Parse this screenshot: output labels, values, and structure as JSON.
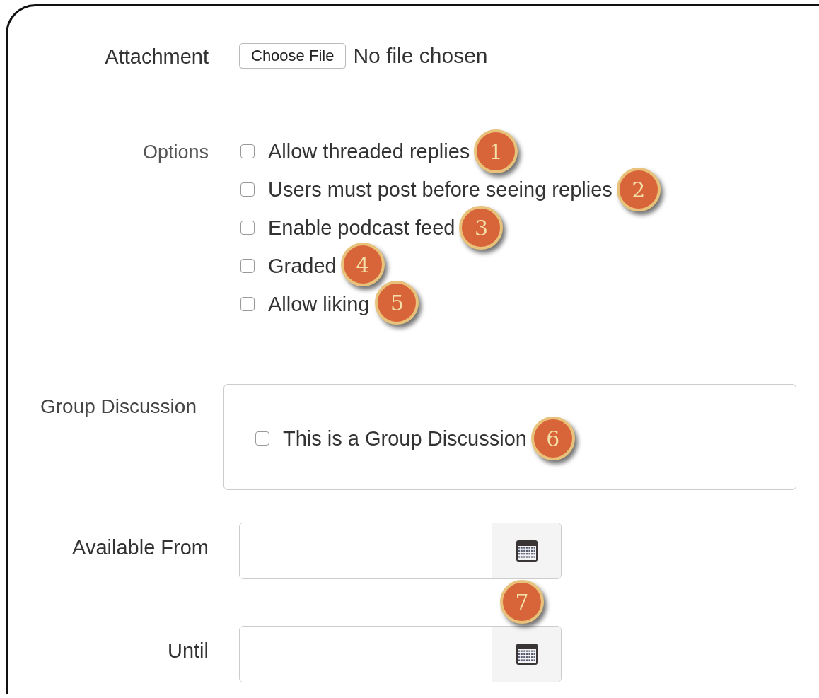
{
  "attachment": {
    "label": "Attachment",
    "button": "Choose File",
    "status": "No file chosen"
  },
  "options": {
    "label": "Options",
    "items": [
      {
        "label": "Allow threaded replies",
        "checked": false,
        "badge": "1"
      },
      {
        "label": "Users must post before seeing replies",
        "checked": false,
        "badge": "2"
      },
      {
        "label": "Enable podcast feed",
        "checked": false,
        "badge": "3"
      },
      {
        "label": "Graded",
        "checked": false,
        "badge": "4"
      },
      {
        "label": "Allow liking",
        "checked": false,
        "badge": "5"
      }
    ]
  },
  "group_discussion": {
    "label": "Group Discussion",
    "checkbox": {
      "label": "This is a Group Discussion",
      "checked": false,
      "badge": "6"
    }
  },
  "dates": [
    {
      "label": "Available From"
    },
    {
      "label": "Until"
    }
  ],
  "dates_badge": "7"
}
